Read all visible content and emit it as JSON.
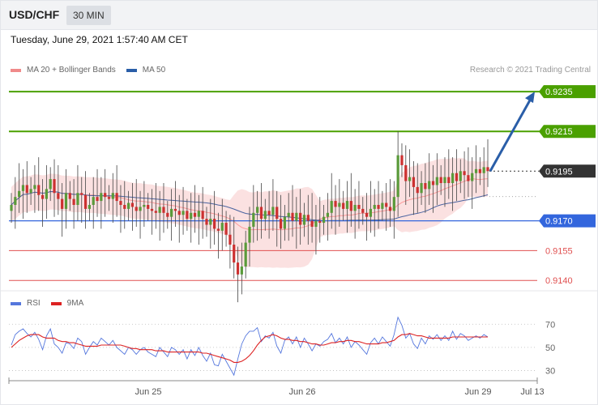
{
  "header": {
    "pair": "USD/CHF",
    "timeframe": "30 MIN"
  },
  "datetime": "Tuesday, June 29, 2021 1:57:40 AM CET",
  "legend": {
    "ma20_label": "MA 20 + Bollinger Bands",
    "ma50_label": "MA 50",
    "rsi_label": "RSI",
    "ma9_label": "9MA"
  },
  "copyright": "Research © 2021 Trading Central",
  "colors": {
    "green_level": "#4aa000",
    "blue_level": "#3366dd",
    "red_level": "#e05050",
    "current": "#333333",
    "arrow": "#2a5ea8",
    "bull": "#5a9a3a",
    "bear": "#cc3030",
    "band": "#fadcdc",
    "ma20": "#ff8888",
    "ma50": "#4a64a0",
    "rsi": "#5577dd",
    "rsi_ma": "#dd2222"
  },
  "chart_data": [
    {
      "type": "candlestick",
      "title": "USD/CHF",
      "timeframe": "30 MIN",
      "ylim": [
        0.9136,
        0.9242
      ],
      "x_ticks": [
        "Jun 25",
        "Jun 26",
        "Jun 29",
        "Jul 13"
      ],
      "closes": [
        0.9178,
        0.9182,
        0.9185,
        0.9188,
        0.9184,
        0.9186,
        0.9188,
        0.9183,
        0.9181,
        0.9186,
        0.9191,
        0.9184,
        0.9181,
        0.9176,
        0.9184,
        0.9181,
        0.9178,
        0.9184,
        0.9183,
        0.9176,
        0.9178,
        0.9182,
        0.918,
        0.9184,
        0.9182,
        0.9181,
        0.9184,
        0.918,
        0.9178,
        0.9176,
        0.9179,
        0.9177,
        0.9175,
        0.9177,
        0.9178,
        0.9176,
        0.9175,
        0.9174,
        0.9177,
        0.9174,
        0.9172,
        0.9176,
        0.9175,
        0.9173,
        0.9175,
        0.9171,
        0.9174,
        0.9172,
        0.9175,
        0.9171,
        0.9168,
        0.9171,
        0.9166,
        0.9165,
        0.9169,
        0.9163,
        0.9158,
        0.9149,
        0.9143,
        0.9147,
        0.9159,
        0.9167,
        0.9174,
        0.9177,
        0.9171,
        0.9175,
        0.9173,
        0.9177,
        0.9171,
        0.9166,
        0.9172,
        0.9174,
        0.917,
        0.9174,
        0.9168,
        0.9173,
        0.917,
        0.9167,
        0.917,
        0.9169,
        0.9172,
        0.9174,
        0.918,
        0.9177,
        0.9179,
        0.9176,
        0.918,
        0.9175,
        0.9178,
        0.9176,
        0.9174,
        0.9172,
        0.9176,
        0.9178,
        0.9176,
        0.9179,
        0.9177,
        0.9175,
        0.9182,
        0.9203,
        0.9198,
        0.919,
        0.9192,
        0.9187,
        0.9184,
        0.9189,
        0.9186,
        0.919,
        0.9188,
        0.9192,
        0.9189,
        0.9192,
        0.9189,
        0.9194,
        0.919,
        0.9195,
        0.9193,
        0.919,
        0.9194,
        0.9196,
        0.9194,
        0.9197,
        0.9195
      ],
      "bollinger": {
        "upper_start": 0.9196,
        "lower_start": 0.9171
      },
      "levels": [
        {
          "value": 0.9235,
          "label": "0.9235",
          "kind": "resistance"
        },
        {
          "value": 0.9215,
          "label": "0.9215",
          "kind": "resistance"
        },
        {
          "value": 0.9195,
          "label": "0.9195",
          "kind": "current"
        },
        {
          "value": 0.917,
          "label": "0.9170",
          "kind": "pivot"
        },
        {
          "value": 0.9155,
          "label": "0.9155",
          "kind": "support"
        },
        {
          "value": 0.914,
          "label": "0.9140",
          "kind": "support"
        }
      ],
      "forecast": {
        "from": 0.9195,
        "to": 0.9235,
        "direction": "up"
      }
    },
    {
      "type": "line",
      "ylim": [
        24,
        80
      ],
      "y_ticks": [
        70,
        50,
        30
      ],
      "series": [
        {
          "name": "RSI",
          "values": [
            52,
            61,
            64,
            66,
            62,
            59,
            63,
            57,
            48,
            60,
            66,
            53,
            50,
            45,
            54,
            53,
            49,
            58,
            55,
            44,
            50,
            55,
            52,
            58,
            55,
            52,
            56,
            50,
            47,
            44,
            50,
            48,
            44,
            48,
            50,
            46,
            44,
            42,
            50,
            46,
            42,
            50,
            48,
            44,
            48,
            40,
            48,
            43,
            50,
            43,
            38,
            45,
            35,
            34,
            44,
            38,
            32,
            26,
            40,
            53,
            60,
            64,
            64,
            67,
            55,
            60,
            58,
            63,
            51,
            45,
            56,
            59,
            53,
            59,
            50,
            58,
            53,
            47,
            53,
            51,
            55,
            57,
            62,
            54,
            58,
            53,
            59,
            50,
            55,
            52,
            48,
            44,
            54,
            58,
            53,
            59,
            55,
            51,
            61,
            76,
            69,
            58,
            62,
            53,
            49,
            58,
            53,
            60,
            57,
            61,
            56,
            60,
            56,
            64,
            57,
            62,
            60,
            56,
            58,
            60,
            58,
            61,
            59
          ]
        },
        {
          "name": "9MA",
          "values": [
            50,
            53,
            56,
            58,
            60,
            61,
            61,
            61,
            59,
            58,
            58,
            58,
            56,
            55,
            55,
            54,
            54,
            53,
            52,
            51,
            51,
            51,
            51,
            52,
            52,
            52,
            52,
            52,
            52,
            51,
            50,
            49,
            49,
            48,
            48,
            48,
            48,
            47,
            47,
            47,
            46,
            46,
            46,
            46,
            46,
            46,
            46,
            46,
            46,
            45,
            45,
            44,
            43,
            42,
            41,
            40,
            39,
            37,
            37,
            38,
            40,
            43,
            47,
            52,
            56,
            59,
            60,
            61,
            60,
            58,
            57,
            57,
            56,
            56,
            55,
            55,
            54,
            53,
            53,
            52,
            52,
            53,
            54,
            54,
            55,
            55,
            56,
            56,
            55,
            55,
            54,
            53,
            53,
            53,
            53,
            54,
            54,
            55,
            56,
            59,
            61,
            61,
            62,
            61,
            60,
            60,
            59,
            58,
            58,
            58,
            58,
            58,
            58,
            59,
            59,
            59,
            59,
            59,
            59,
            59,
            59,
            59,
            59
          ]
        }
      ],
      "x_ticks": [
        "Jun 25",
        "Jun 26",
        "Jun 29",
        "Jul 13"
      ]
    }
  ]
}
